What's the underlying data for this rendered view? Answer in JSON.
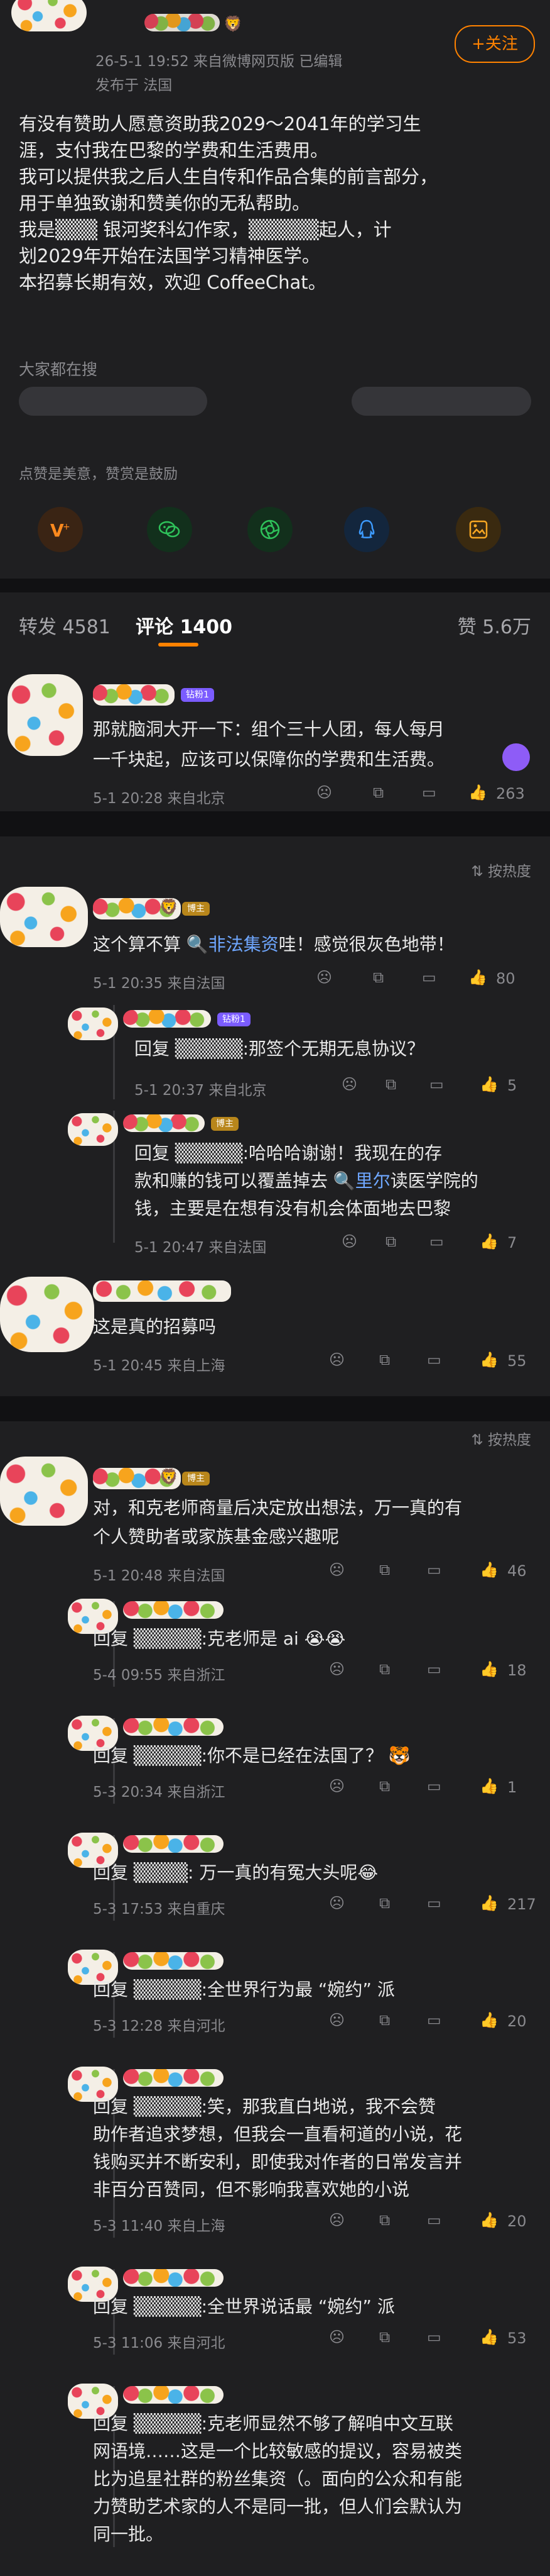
{
  "post": {
    "time_line": "26-5-1 19:52  来自微博网页版  已编辑",
    "location_line": "发布于 法国",
    "follow_label": "+关注",
    "body_lines": [
      "有没有赞助人愿意资助我2029～2041年的学习生",
      "涯，支付我在巴黎的学费和生活费用。",
      "我可以提供我之后人生自传和作品合集的前言部分，",
      "用于单独致谢和赞美你的无私帮助。",
      "我是▒▒▒  银河奖科幻作家，▒▒▒▒▒起人，计",
      "划2029年开始在法国学习精神医学。",
      "本招募长期有效，欢迎 CoffeeChat。"
    ],
    "search_label": "大家都在搜"
  },
  "reward": {
    "caption": "点赞是美意，赞赏是鼓励"
  },
  "tabs": {
    "repost": "转发 4581",
    "comments": "评论 1400",
    "likes": "赞 5.6万"
  },
  "sort_label": "按热度",
  "comments": [
    {
      "badge": "钻粉1",
      "lines": [
        "那就脑洞大开一下：组个三十人团，每人每月",
        "一千块起，应该可以保障你的学费和生活费。"
      ],
      "meta": "5-1 20:28  来自北京",
      "likes": "263"
    },
    {
      "badge": "博主",
      "text_pre": "这个算不算 ",
      "text_link": "非法集资",
      "text_post": "哇！感觉很灰色地带！",
      "meta": "5-1 20:35  来自法国",
      "likes": "80",
      "replies": [
        {
          "badge": "钻粉1",
          "text": "回复 ▒▒▒▒▒:那签个无期无息协议？",
          "meta": "5-1 20:37  来自北京",
          "likes": "5"
        },
        {
          "badge": "博主",
          "line1": "回复 ▒▒▒▒▒:哈哈哈谢谢！我现在的存",
          "line2_pre": "款和赚的钱可以覆盖掉去 ",
          "line2_link": "里尔",
          "line2_post": "读医学院的",
          "line3": "钱，主要是在想有没有机会体面地去巴黎",
          "meta": "5-1 20:47  来自法国",
          "likes": "7"
        }
      ]
    },
    {
      "text": "这是真的招募吗",
      "meta": "5-1 20:45  来自上海",
      "likes": "55"
    },
    {
      "badge": "博主",
      "lines": [
        "对，和克老师商量后决定放出想法，万一真的有",
        "个人赞助者或家族基金感兴趣呢"
      ],
      "meta": "5-1 20:48  来自法国",
      "likes": "46",
      "replies": [
        {
          "text": "回复 ▒▒▒▒▒:克老师是 ai 😭😭",
          "meta": "5-4 09:55  来自浙江",
          "likes": "18"
        },
        {
          "text": "回复 ▒▒▒▒▒:你不是已经在法国了？ 🐯",
          "meta": "5-3 20:34  来自浙江",
          "likes": "1"
        },
        {
          "text": "回复 ▒▒▒▒:  万一真的有冤大头呢😂",
          "meta": "5-3 17:53  来自重庆",
          "likes": "217"
        },
        {
          "text": "回复 ▒▒▒▒▒:全世界行为最 “婉约” 派",
          "meta": "5-3 12:28  来自河北",
          "likes": "20"
        },
        {
          "lines": [
            "回复 ▒▒▒▒▒:笑，那我直白地说，我不会赞",
            "助作者追求梦想，但我会一直看柯道的小说，花",
            "钱购买并不断安利，即使我对作者的日常发言并",
            "非百分百赞同，但不影响我喜欢她的小说"
          ],
          "meta": "5-3 11:40  来自上海",
          "likes": "20"
        },
        {
          "text": "回复 ▒▒▒▒▒:全世界说话最 “婉约” 派",
          "meta": "5-3 11:06  来自河北",
          "likes": "53"
        },
        {
          "lines": [
            "回复 ▒▒▒▒▒:克老师显然不够了解咱中文互联",
            "网语境……这是一个比较敏感的提议，容易被类",
            "比为追星社群的粉丝集资（。面向的公众和有能",
            "力赞助艺术家的人不是同一批，但人们会默认为",
            "同一批。"
          ]
        }
      ]
    }
  ],
  "colors": {
    "background": "#1b1b1d",
    "card": "#1f1f21",
    "link": "#6fa7ff",
    "follow": "#ff8200",
    "vip_badge": "#7b5cff",
    "owner_badge": "#b8861b"
  }
}
